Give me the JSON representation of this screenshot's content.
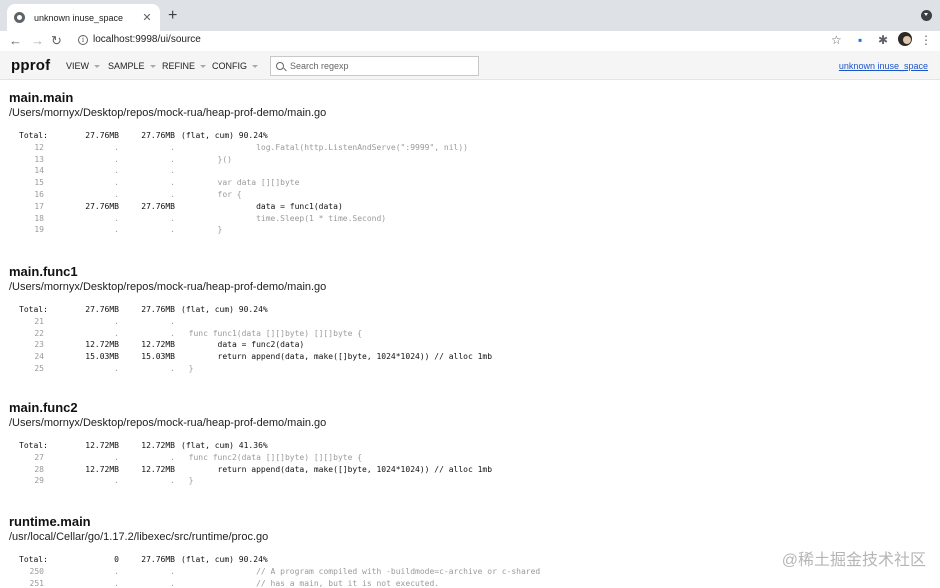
{
  "browser": {
    "tab_title": "unknown inuse_space",
    "tab_close": "✕",
    "new_tab": "+",
    "url": "localhost:9998/ui/source",
    "icons": [
      "back-icon",
      "forward-icon",
      "reload-icon",
      "info-icon",
      "star-icon",
      "extension-icon",
      "puzzle-icon",
      "avatar",
      "menu-icon"
    ]
  },
  "pprof": {
    "logo": "pprof",
    "menus": [
      "VIEW",
      "SAMPLE",
      "REFINE",
      "CONFIG"
    ],
    "search_placeholder": "Search regexp",
    "profile_link": "unknown inuse_space"
  },
  "functions": [
    {
      "name": "main.main",
      "file": "/Users/mornyx/Desktop/repos/mock-rua/heap-prof-demo/main.go",
      "total": {
        "label": "Total:",
        "flat": "27.76MB",
        "cum": "27.76MB",
        "rest": "(flat, cum) 90.24%"
      },
      "lines": [
        {
          "ln": "12",
          "flat": ".",
          "cum": ".",
          "code": "                log.Fatal(http.ListenAndServe(\":9999\", nil))",
          "hot": false
        },
        {
          "ln": "13",
          "flat": ".",
          "cum": ".",
          "code": "        }()",
          "hot": false
        },
        {
          "ln": "14",
          "flat": ".",
          "cum": ".",
          "code": "",
          "hot": false
        },
        {
          "ln": "15",
          "flat": ".",
          "cum": ".",
          "code": "        var data [][]byte",
          "hot": false
        },
        {
          "ln": "16",
          "flat": ".",
          "cum": ".",
          "code": "        for {",
          "hot": false
        },
        {
          "ln": "17",
          "flat": "27.76MB",
          "cum": "27.76MB",
          "code": "                data = func1(data)",
          "hot": true
        },
        {
          "ln": "18",
          "flat": ".",
          "cum": ".",
          "code": "                time.Sleep(1 * time.Second)",
          "hot": false
        },
        {
          "ln": "19",
          "flat": ".",
          "cum": ".",
          "code": "        }",
          "hot": false
        }
      ]
    },
    {
      "name": "main.func1",
      "file": "/Users/mornyx/Desktop/repos/mock-rua/heap-prof-demo/main.go",
      "total": {
        "label": "Total:",
        "flat": "27.76MB",
        "cum": "27.76MB",
        "rest": "(flat, cum) 90.24%"
      },
      "lines": [
        {
          "ln": "21",
          "flat": ".",
          "cum": ".",
          "code": "",
          "hot": false
        },
        {
          "ln": "22",
          "flat": ".",
          "cum": ".",
          "code": "  func func1(data [][]byte) [][]byte {",
          "hot": false
        },
        {
          "ln": "23",
          "flat": "12.72MB",
          "cum": "12.72MB",
          "code": "        data = func2(data)",
          "hot": true
        },
        {
          "ln": "24",
          "flat": "15.03MB",
          "cum": "15.03MB",
          "code": "        return append(data, make([]byte, 1024*1024)) // alloc 1mb",
          "hot": true
        },
        {
          "ln": "25",
          "flat": ".",
          "cum": ".",
          "code": "  }",
          "hot": false
        }
      ]
    },
    {
      "name": "main.func2",
      "file": "/Users/mornyx/Desktop/repos/mock-rua/heap-prof-demo/main.go",
      "total": {
        "label": "Total:",
        "flat": "12.72MB",
        "cum": "12.72MB",
        "rest": "(flat, cum) 41.36%"
      },
      "lines": [
        {
          "ln": "27",
          "flat": ".",
          "cum": ".",
          "code": "  func func2(data [][]byte) [][]byte {",
          "hot": false
        },
        {
          "ln": "28",
          "flat": "12.72MB",
          "cum": "12.72MB",
          "code": "        return append(data, make([]byte, 1024*1024)) // alloc 1mb",
          "hot": true
        },
        {
          "ln": "29",
          "flat": ".",
          "cum": ".",
          "code": "  }",
          "hot": false
        }
      ]
    },
    {
      "name": "runtime.main",
      "file": "/usr/local/Cellar/go/1.17.2/libexec/src/runtime/proc.go",
      "total": {
        "label": "Total:",
        "flat": "0",
        "cum": "27.76MB",
        "rest": "(flat, cum) 90.24%"
      },
      "lines": [
        {
          "ln": "250",
          "flat": ".",
          "cum": ".",
          "code": "                // A program compiled with -buildmode=c-archive or c-shared",
          "hot": false
        },
        {
          "ln": "251",
          "flat": ".",
          "cum": ".",
          "code": "                // has a main, but it is not executed.",
          "hot": false
        }
      ]
    }
  ],
  "watermark": "@稀土掘金技术社区"
}
